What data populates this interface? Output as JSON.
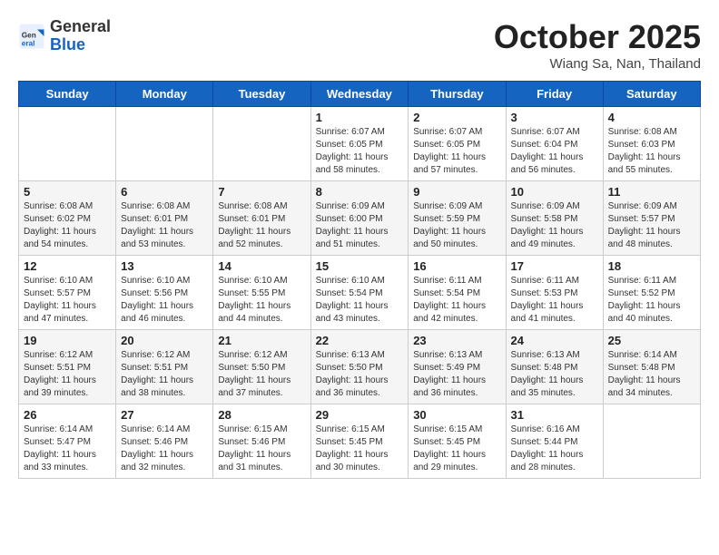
{
  "header": {
    "logo_general": "General",
    "logo_blue": "Blue",
    "month_title": "October 2025",
    "location": "Wiang Sa, Nan, Thailand"
  },
  "days_of_week": [
    "Sunday",
    "Monday",
    "Tuesday",
    "Wednesday",
    "Thursday",
    "Friday",
    "Saturday"
  ],
  "weeks": [
    [
      {
        "day": "",
        "info": ""
      },
      {
        "day": "",
        "info": ""
      },
      {
        "day": "",
        "info": ""
      },
      {
        "day": "1",
        "info": "Sunrise: 6:07 AM\nSunset: 6:05 PM\nDaylight: 11 hours\nand 58 minutes."
      },
      {
        "day": "2",
        "info": "Sunrise: 6:07 AM\nSunset: 6:05 PM\nDaylight: 11 hours\nand 57 minutes."
      },
      {
        "day": "3",
        "info": "Sunrise: 6:07 AM\nSunset: 6:04 PM\nDaylight: 11 hours\nand 56 minutes."
      },
      {
        "day": "4",
        "info": "Sunrise: 6:08 AM\nSunset: 6:03 PM\nDaylight: 11 hours\nand 55 minutes."
      }
    ],
    [
      {
        "day": "5",
        "info": "Sunrise: 6:08 AM\nSunset: 6:02 PM\nDaylight: 11 hours\nand 54 minutes."
      },
      {
        "day": "6",
        "info": "Sunrise: 6:08 AM\nSunset: 6:01 PM\nDaylight: 11 hours\nand 53 minutes."
      },
      {
        "day": "7",
        "info": "Sunrise: 6:08 AM\nSunset: 6:01 PM\nDaylight: 11 hours\nand 52 minutes."
      },
      {
        "day": "8",
        "info": "Sunrise: 6:09 AM\nSunset: 6:00 PM\nDaylight: 11 hours\nand 51 minutes."
      },
      {
        "day": "9",
        "info": "Sunrise: 6:09 AM\nSunset: 5:59 PM\nDaylight: 11 hours\nand 50 minutes."
      },
      {
        "day": "10",
        "info": "Sunrise: 6:09 AM\nSunset: 5:58 PM\nDaylight: 11 hours\nand 49 minutes."
      },
      {
        "day": "11",
        "info": "Sunrise: 6:09 AM\nSunset: 5:57 PM\nDaylight: 11 hours\nand 48 minutes."
      }
    ],
    [
      {
        "day": "12",
        "info": "Sunrise: 6:10 AM\nSunset: 5:57 PM\nDaylight: 11 hours\nand 47 minutes."
      },
      {
        "day": "13",
        "info": "Sunrise: 6:10 AM\nSunset: 5:56 PM\nDaylight: 11 hours\nand 46 minutes."
      },
      {
        "day": "14",
        "info": "Sunrise: 6:10 AM\nSunset: 5:55 PM\nDaylight: 11 hours\nand 44 minutes."
      },
      {
        "day": "15",
        "info": "Sunrise: 6:10 AM\nSunset: 5:54 PM\nDaylight: 11 hours\nand 43 minutes."
      },
      {
        "day": "16",
        "info": "Sunrise: 6:11 AM\nSunset: 5:54 PM\nDaylight: 11 hours\nand 42 minutes."
      },
      {
        "day": "17",
        "info": "Sunrise: 6:11 AM\nSunset: 5:53 PM\nDaylight: 11 hours\nand 41 minutes."
      },
      {
        "day": "18",
        "info": "Sunrise: 6:11 AM\nSunset: 5:52 PM\nDaylight: 11 hours\nand 40 minutes."
      }
    ],
    [
      {
        "day": "19",
        "info": "Sunrise: 6:12 AM\nSunset: 5:51 PM\nDaylight: 11 hours\nand 39 minutes."
      },
      {
        "day": "20",
        "info": "Sunrise: 6:12 AM\nSunset: 5:51 PM\nDaylight: 11 hours\nand 38 minutes."
      },
      {
        "day": "21",
        "info": "Sunrise: 6:12 AM\nSunset: 5:50 PM\nDaylight: 11 hours\nand 37 minutes."
      },
      {
        "day": "22",
        "info": "Sunrise: 6:13 AM\nSunset: 5:50 PM\nDaylight: 11 hours\nand 36 minutes."
      },
      {
        "day": "23",
        "info": "Sunrise: 6:13 AM\nSunset: 5:49 PM\nDaylight: 11 hours\nand 36 minutes."
      },
      {
        "day": "24",
        "info": "Sunrise: 6:13 AM\nSunset: 5:48 PM\nDaylight: 11 hours\nand 35 minutes."
      },
      {
        "day": "25",
        "info": "Sunrise: 6:14 AM\nSunset: 5:48 PM\nDaylight: 11 hours\nand 34 minutes."
      }
    ],
    [
      {
        "day": "26",
        "info": "Sunrise: 6:14 AM\nSunset: 5:47 PM\nDaylight: 11 hours\nand 33 minutes."
      },
      {
        "day": "27",
        "info": "Sunrise: 6:14 AM\nSunset: 5:46 PM\nDaylight: 11 hours\nand 32 minutes."
      },
      {
        "day": "28",
        "info": "Sunrise: 6:15 AM\nSunset: 5:46 PM\nDaylight: 11 hours\nand 31 minutes."
      },
      {
        "day": "29",
        "info": "Sunrise: 6:15 AM\nSunset: 5:45 PM\nDaylight: 11 hours\nand 30 minutes."
      },
      {
        "day": "30",
        "info": "Sunrise: 6:15 AM\nSunset: 5:45 PM\nDaylight: 11 hours\nand 29 minutes."
      },
      {
        "day": "31",
        "info": "Sunrise: 6:16 AM\nSunset: 5:44 PM\nDaylight: 11 hours\nand 28 minutes."
      },
      {
        "day": "",
        "info": ""
      }
    ]
  ]
}
